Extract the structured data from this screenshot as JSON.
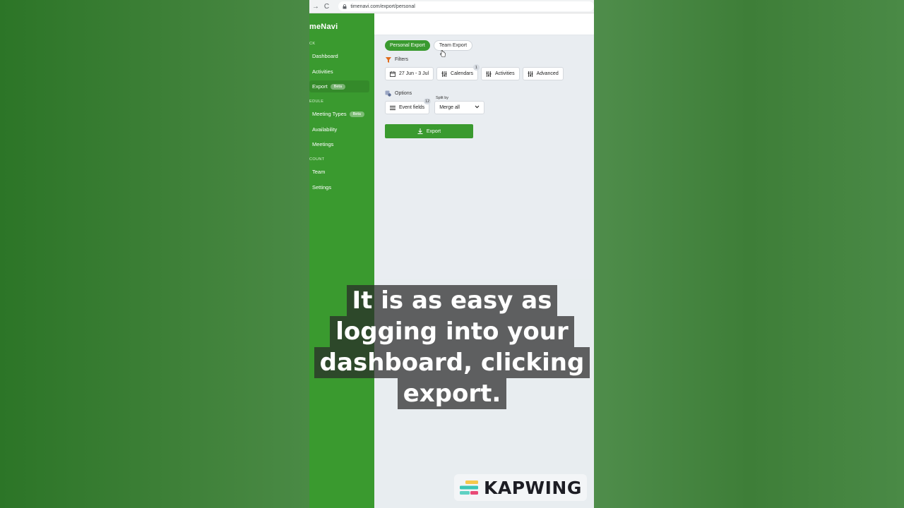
{
  "browser": {
    "url": "timenavi.com/export/personal",
    "back_glyph": "→",
    "reload_glyph": "C"
  },
  "sidebar": {
    "logo": "meNavi",
    "sections": [
      {
        "label": "CK"
      },
      {
        "label": "EDULE"
      },
      {
        "label": "COUNT"
      }
    ],
    "items": [
      {
        "label": "Dashboard"
      },
      {
        "label": "Activities"
      },
      {
        "label": "Export",
        "badge": "Beta"
      },
      {
        "label": "Meeting Types",
        "badge": "Beta"
      },
      {
        "label": "Availability"
      },
      {
        "label": "Meetings"
      },
      {
        "label": "Team"
      },
      {
        "label": "Settings"
      }
    ]
  },
  "main": {
    "tabs": [
      {
        "label": "Personal Export"
      },
      {
        "label": "Team Export"
      }
    ],
    "filters_label": "Filters",
    "filters": [
      {
        "label": "27 Jun - 3 Jul",
        "icon": "calendar-icon"
      },
      {
        "label": "Calendars",
        "icon": "sliders-icon",
        "count": "1"
      },
      {
        "label": "Activities",
        "icon": "sliders-icon"
      },
      {
        "label": "Advanced",
        "icon": "sliders-icon"
      }
    ],
    "options_label": "Options",
    "event_fields": {
      "label": "Event fields",
      "count": "12"
    },
    "split_by": {
      "label": "Split by",
      "value": "Merge all"
    },
    "export_button": "Export"
  },
  "captions": [
    "It is as easy as",
    "logging into your",
    "dashboard, clicking",
    "export."
  ],
  "watermark": "KAPWING",
  "colors": {
    "brand_green": "#3a9a2f",
    "background_green": "#3a7a35",
    "filter_icon": "#e06a1b"
  }
}
